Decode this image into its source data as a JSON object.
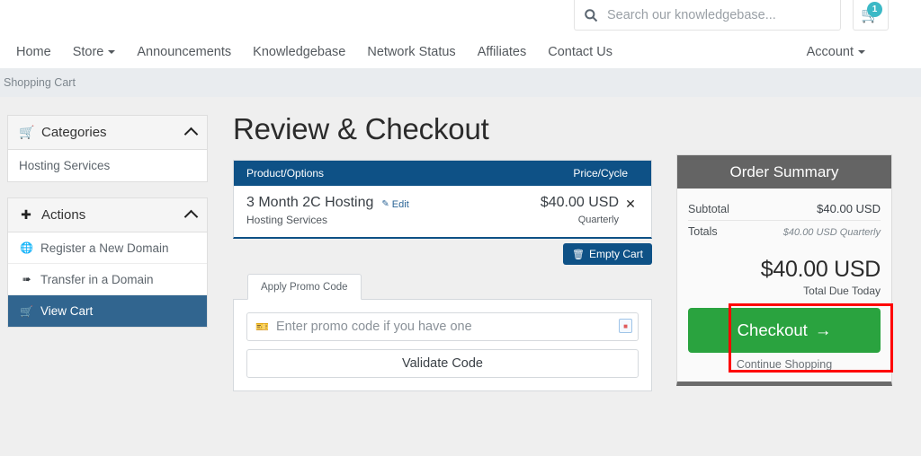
{
  "header": {
    "search": {
      "placeholder": "Search our knowledgebase...",
      "icon": "search-icon",
      "value": ""
    },
    "cart": {
      "icon": "shopping-cart-icon",
      "badge_count": "1",
      "badge_color": "#3cb9c6"
    }
  },
  "nav": {
    "items": [
      {
        "label": "Home",
        "has_caret": false
      },
      {
        "label": "Store",
        "has_caret": true
      },
      {
        "label": "Announcements",
        "has_caret": false
      },
      {
        "label": "Knowledgebase",
        "has_caret": false
      },
      {
        "label": "Network Status",
        "has_caret": false
      },
      {
        "label": "Affiliates",
        "has_caret": false
      },
      {
        "label": "Contact Us",
        "has_caret": false
      }
    ],
    "account": {
      "label": "Account",
      "has_caret": true
    }
  },
  "breadcrumb": {
    "text": "Shopping Cart"
  },
  "sidebar": {
    "categories": {
      "title": "Categories",
      "icon": "shopping-cart-icon",
      "collapse_icon": "chevron-up-icon",
      "items": [
        {
          "label": "Hosting Services",
          "icon": "",
          "active": false
        }
      ]
    },
    "actions": {
      "title": "Actions",
      "icon": "plus-icon",
      "collapse_icon": "chevron-up-icon",
      "items": [
        {
          "label": "Register a New Domain",
          "icon": "globe-icon",
          "glyph": "⊕",
          "active": false
        },
        {
          "label": "Transfer in a Domain",
          "icon": "arrow-curve-icon",
          "glyph": "↪",
          "active": false
        },
        {
          "label": "View Cart",
          "icon": "shopping-cart-icon",
          "glyph": "🛒",
          "active": true
        }
      ]
    }
  },
  "main": {
    "page_title": "Review & Checkout",
    "cart_table": {
      "columns": [
        "Product/Options",
        "Price/Cycle"
      ],
      "header_bg": "#0e5186",
      "rows": [
        {
          "product": "3 Month 2C Hosting",
          "edit_label": "Edit",
          "edit_icon": "pencil-icon",
          "category": "Hosting Services",
          "price": "$40.00 USD",
          "cycle": "Quarterly",
          "remove_icon": "close-x-icon"
        }
      ]
    },
    "empty_cart": {
      "label": "Empty Cart",
      "icon": "trash-icon"
    },
    "promo": {
      "tab_label": "Apply Promo Code",
      "input_placeholder": "Enter promo code if you have one",
      "input_value": "",
      "input_icon": "ticket-icon",
      "autofill_icon": "autofill-icon",
      "validate_label": "Validate Code"
    }
  },
  "order_summary": {
    "title": "Order Summary",
    "header_bg": "#646464",
    "rows": [
      {
        "label": "Subtotal",
        "value": "$40.00 USD",
        "emphasis": false
      },
      {
        "label": "Totals",
        "value": "$40.00 USD Quarterly",
        "emphasis": true
      }
    ],
    "grand_total": "$40.00 USD",
    "grand_total_label": "Total Due Today",
    "checkout": {
      "label": "Checkout",
      "arrow": "→",
      "color": "#2aa33f"
    },
    "continue_label": "Continue Shopping"
  },
  "annotation": {
    "type": "highlight-rectangle",
    "color": "#ff0000",
    "target": "checkout-button"
  }
}
